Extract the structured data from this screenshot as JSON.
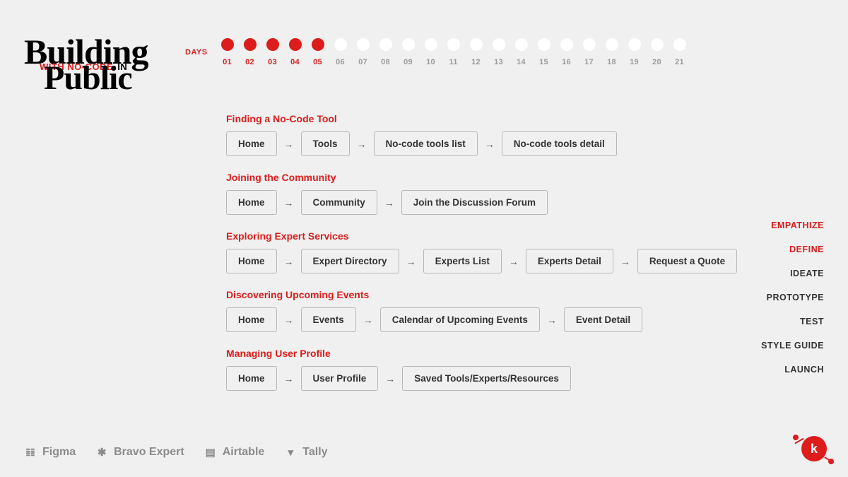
{
  "logo": {
    "line1": "Building",
    "mid_red": "WITH NO-CODE",
    "mid_in": "IN",
    "line2": "Public"
  },
  "days": {
    "label": "DAYS",
    "items": [
      {
        "num": "01",
        "active": true
      },
      {
        "num": "02",
        "active": true
      },
      {
        "num": "03",
        "active": true
      },
      {
        "num": "04",
        "active": true
      },
      {
        "num": "05",
        "active": true
      },
      {
        "num": "06",
        "active": false
      },
      {
        "num": "07",
        "active": false
      },
      {
        "num": "08",
        "active": false
      },
      {
        "num": "09",
        "active": false
      },
      {
        "num": "10",
        "active": false
      },
      {
        "num": "11",
        "active": false
      },
      {
        "num": "12",
        "active": false
      },
      {
        "num": "13",
        "active": false
      },
      {
        "num": "14",
        "active": false
      },
      {
        "num": "15",
        "active": false
      },
      {
        "num": "16",
        "active": false
      },
      {
        "num": "17",
        "active": false
      },
      {
        "num": "18",
        "active": false
      },
      {
        "num": "19",
        "active": false
      },
      {
        "num": "20",
        "active": false
      },
      {
        "num": "21",
        "active": false
      }
    ]
  },
  "flows": [
    {
      "title": "Finding a No-Code Tool",
      "steps": [
        "Home",
        "Tools",
        "No-code tools list",
        "No-code tools detail"
      ]
    },
    {
      "title": "Joining the Community",
      "steps": [
        "Home",
        "Community",
        "Join the Discussion Forum"
      ]
    },
    {
      "title": "Exploring Expert Services",
      "steps": [
        "Home",
        "Expert Directory",
        "Experts List",
        "Experts Detail",
        "Request a Quote"
      ]
    },
    {
      "title": "Discovering Upcoming Events",
      "steps": [
        "Home",
        "Events",
        "Calendar of Upcoming Events",
        "Event Detail"
      ]
    },
    {
      "title": "Managing User Profile",
      "steps": [
        "Home",
        "User Profile",
        "Saved Tools/Experts/Resources"
      ]
    }
  ],
  "right_nav": [
    {
      "label": "EMPATHIZE",
      "active": true
    },
    {
      "label": "DEFINE",
      "active": true
    },
    {
      "label": "IDEATE",
      "active": false
    },
    {
      "label": "PROTOTYPE",
      "active": false
    },
    {
      "label": "TEST",
      "active": false
    },
    {
      "label": "STYLE GUIDE",
      "active": false
    },
    {
      "label": "LAUNCH",
      "active": false
    }
  ],
  "footer_tools": [
    {
      "icon": "figma-icon",
      "glyph": "𝌮",
      "label": "Figma"
    },
    {
      "icon": "bravo-icon",
      "glyph": "✱",
      "label": "Bravo Expert"
    },
    {
      "icon": "airtable-icon",
      "glyph": "▤",
      "label": "Airtable"
    },
    {
      "icon": "tally-icon",
      "glyph": "▾",
      "label": "Tally"
    }
  ],
  "corner_brand": {
    "letter": "k"
  }
}
